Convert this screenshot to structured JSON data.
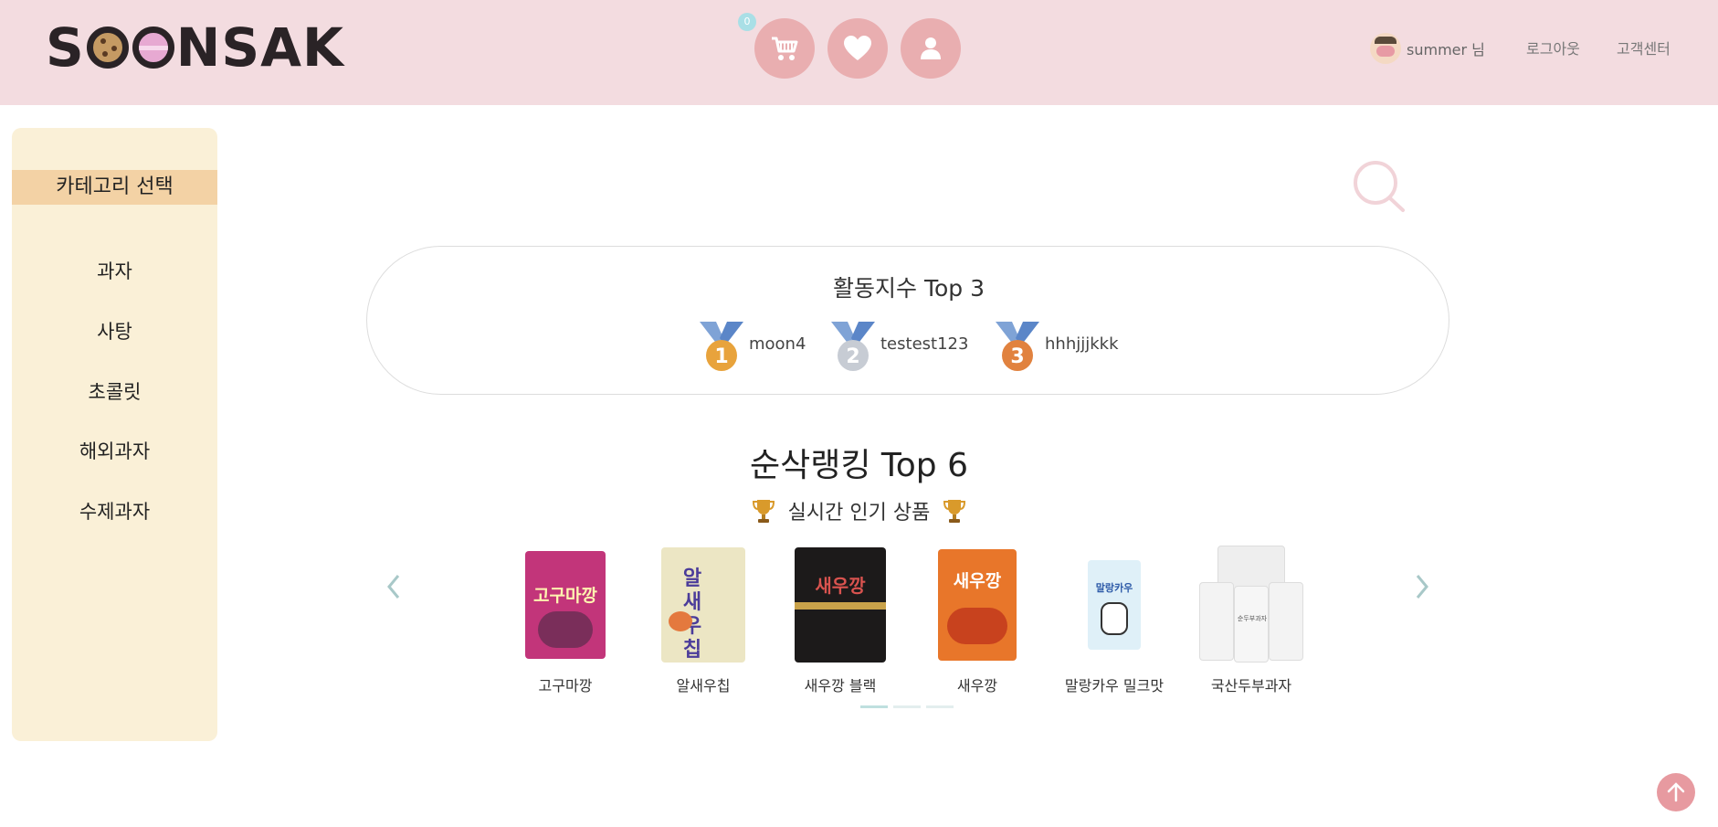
{
  "header": {
    "logo_text": "SOONSAK",
    "cart_count": "0",
    "user_name": "summer 님",
    "logout_label": "로그아웃",
    "support_label": "고객센터"
  },
  "sidebar": {
    "title": "카테고리 선택",
    "items": [
      {
        "label": "과자"
      },
      {
        "label": "사탕"
      },
      {
        "label": "초콜릿"
      },
      {
        "label": "해외과자"
      },
      {
        "label": "수제과자"
      }
    ]
  },
  "activity": {
    "title": "활동지수 Top 3",
    "ranks": [
      {
        "place": "1",
        "name": "moon4",
        "color": "#e8a33c"
      },
      {
        "place": "2",
        "name": "testest123",
        "color": "#c7ccd4"
      },
      {
        "place": "3",
        "name": "hhhjjjkkk",
        "color": "#e1823f"
      }
    ]
  },
  "ranking": {
    "title": "순삭랭킹 Top 6",
    "subtitle": "실시간 인기 상품",
    "products": [
      {
        "name": "고구마깡",
        "bag_text": "고구마깡"
      },
      {
        "name": "알새우칩",
        "bag_text": "알새우칩"
      },
      {
        "name": "새우깡 블랙",
        "bag_text": "새우깡"
      },
      {
        "name": "새우깡",
        "bag_text": "새우깡"
      },
      {
        "name": "말랑카우 밀크맛",
        "bag_text": "말랑카우"
      },
      {
        "name": "국산두부과자",
        "bag_text": "순두부과자"
      }
    ]
  },
  "colors": {
    "header_bg": "#f3dce0",
    "icon_button": "#e9aeb0",
    "sidebar_bg": "#faf0d7",
    "sidebar_title_bg": "#f3d2a5"
  }
}
